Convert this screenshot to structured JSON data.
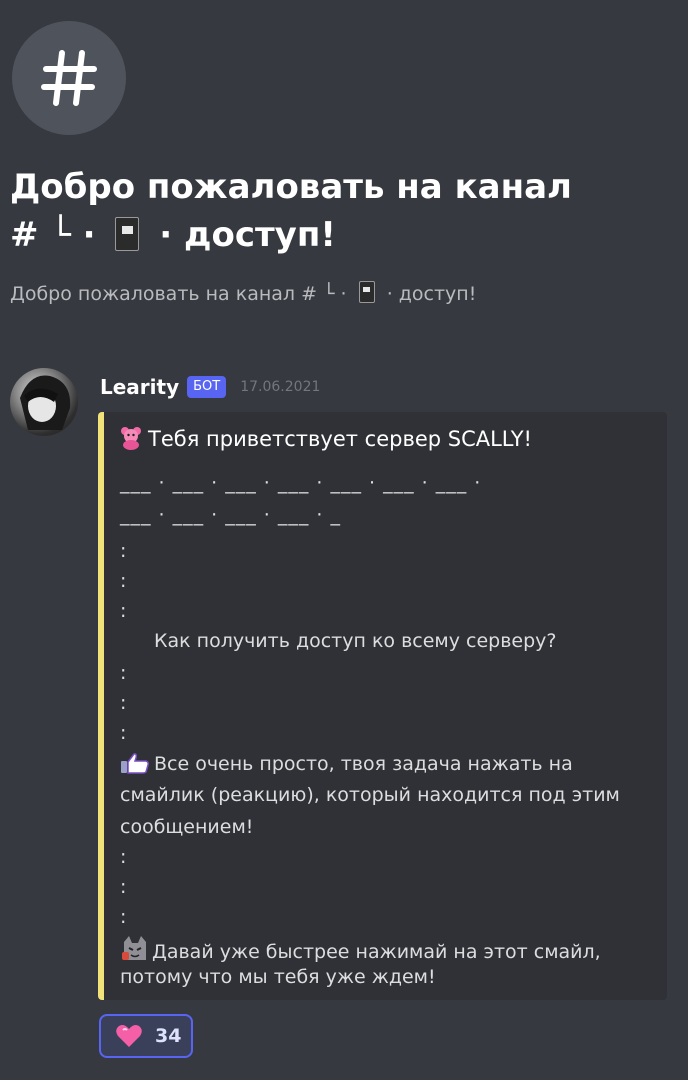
{
  "channel": {
    "icon": "hashtag-icon",
    "welcome_title_line1": "Добро пожаловать на канал",
    "welcome_title_line2_prefix": "# └ ·",
    "welcome_title_line2_suffix": "· доступ!",
    "welcome_subtitle_prefix": "Добро пожаловать на канал # └ ·",
    "welcome_subtitle_suffix": "· доступ!"
  },
  "message": {
    "username": "Learity",
    "badge": "БОТ",
    "timestamp": "17.06.2021",
    "embed": {
      "accent_color": "#f1e27a",
      "title": "Тебя приветствует сервер SCALLY!",
      "divider_line1": "___ · ___ · ___ · ___ · ___ · ___ · ___ ·",
      "divider_line2": "___ · ___ · ___ · ___ · _",
      "dot": ":",
      "question": "Как получить доступ ко всему серверу?",
      "step_line1": "Все очень просто, твоя задача нажать на",
      "step_line2": "смайлик (реакцию), который находится под этим",
      "step_line3": "сообщением!",
      "final_line1": "Давай уже быстрее нажимай на этот смайл,",
      "final_line2": "потому что мы тебя уже ждем!"
    },
    "reaction": {
      "emoji": "pink-heart-icon",
      "count": "34"
    }
  },
  "colors": {
    "background": "#36393f",
    "embed_background": "#2f3136",
    "bot_badge": "#5865f2"
  }
}
